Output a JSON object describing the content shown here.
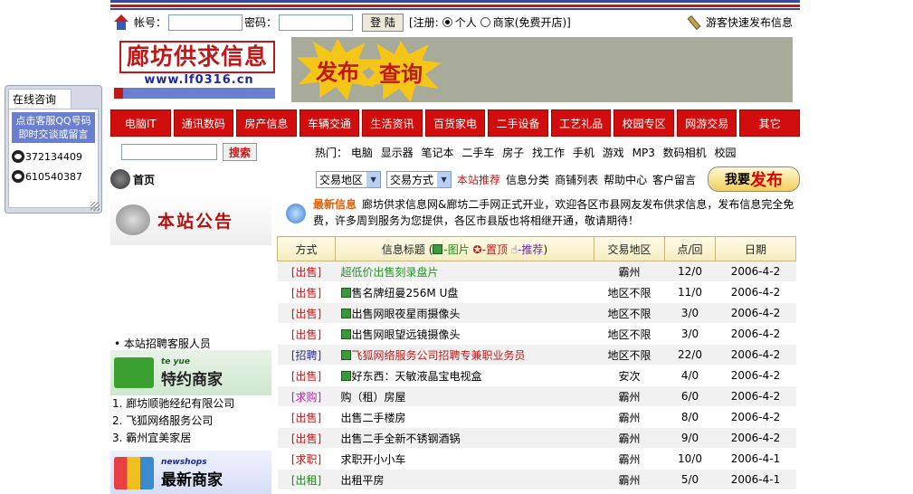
{
  "consult": {
    "title": "在线咨询",
    "tip": "点击客服QQ号码即时交谈或留言",
    "qq": [
      "372134409",
      "610540387"
    ]
  },
  "login": {
    "account_label": "帐号：",
    "password_label": "密码：",
    "login_button": "登 陆",
    "register_label": "[注册:",
    "opt_personal": "个人",
    "opt_business": "商家(免费开店)",
    "close_bracket": "]",
    "guest_publish": "游客快速发布信息"
  },
  "banner": {
    "logo_title": "廊坊供求信息网",
    "logo_url": "www.lf0316.cn",
    "ad_publish": "发布",
    "ad_query": "查询"
  },
  "nav": [
    "电脑IT",
    "通讯数码",
    "房产信息",
    "车辆交通",
    "生活资讯",
    "百货家电",
    "二手设备",
    "工艺礼品",
    "校园专区",
    "网游交易",
    "其它"
  ],
  "search": {
    "button": "搜索",
    "hot_label": "热门：",
    "hot": [
      "电脑",
      "显示器",
      "笔记本",
      "二手车",
      "房子",
      "找工作",
      "手机",
      "游戏",
      "MP3",
      "数码相机",
      "校园"
    ]
  },
  "toolbar": {
    "home": "首页",
    "region_select": "交易地区",
    "method_select": "交易方式",
    "links": [
      "本站推荐",
      "信息分类",
      "商铺列表",
      "帮助中心",
      "客户留言"
    ],
    "publish_btn_a": "我要",
    "publish_btn_b": "发布"
  },
  "left": {
    "announce_title": "本站公告",
    "notice": "• 本站招聘客服人员",
    "special_en": "te yue",
    "special_title": "特约商家",
    "special_list": [
      "1. 廊坊顺驰经纪有限公司",
      "2. 飞狐网络服务公司",
      "3. 霸州宜美家居"
    ],
    "new_en": "newshops",
    "new_title": "最新商家"
  },
  "news": {
    "label": "最新信息",
    "text": "廊坊供求信息网&廊坊二手网正式开业，欢迎各区市县网友发布供求信息，发布信息完全免费，许多周到服务为您提供，各区市县版也将相继开通，敬请期待！"
  },
  "table": {
    "headers": {
      "method": "方式",
      "title": "信息标题",
      "legend_pic": "-图片",
      "legend_top": "-置顶",
      "legend_rec": "-推荐",
      "region": "交易地区",
      "hits": "点/回",
      "date": "日期"
    },
    "rows": [
      {
        "type": "[出售]",
        "title": "超低价出售刻录盘片",
        "pic": false,
        "style": "green",
        "region": "霸州",
        "hits": "12/0",
        "date": "2006-4-2"
      },
      {
        "type": "[出售]",
        "title": "售名牌纽曼256M U盘",
        "pic": true,
        "style": "",
        "region": "地区不限",
        "hits": "11/0",
        "date": "2006-4-2"
      },
      {
        "type": "[出售]",
        "title": "出售网眼夜星雨摄像头",
        "pic": true,
        "style": "",
        "region": "地区不限",
        "hits": "3/0",
        "date": "2006-4-2"
      },
      {
        "type": "[出售]",
        "title": "出售网眼望远镜摄像头",
        "pic": true,
        "style": "",
        "region": "地区不限",
        "hits": "3/0",
        "date": "2006-4-2"
      },
      {
        "type": "[招聘]",
        "title": "飞狐网络服务公司招聘专兼职业务员",
        "pic": true,
        "style": "red",
        "region": "地区不限",
        "hits": "22/0",
        "date": "2006-4-2"
      },
      {
        "type": "[出售]",
        "title": "好东西：天敏液晶宝电视盒",
        "pic": true,
        "style": "",
        "region": "安次",
        "hits": "4/0",
        "date": "2006-4-2"
      },
      {
        "type": "[求购]",
        "title": "购（租）房屋",
        "pic": false,
        "style": "",
        "region": "霸州",
        "hits": "6/0",
        "date": "2006-4-2"
      },
      {
        "type": "[出售]",
        "title": "出售二手楼房",
        "pic": false,
        "style": "",
        "region": "霸州",
        "hits": "8/0",
        "date": "2006-4-2"
      },
      {
        "type": "[出售]",
        "title": "出售二手全新不锈钢酒锅",
        "pic": false,
        "style": "",
        "region": "霸州",
        "hits": "9/0",
        "date": "2006-4-2"
      },
      {
        "type": "[求职]",
        "title": "求职开小小车",
        "pic": false,
        "style": "",
        "region": "霸州",
        "hits": "10/0",
        "date": "2006-4-1"
      },
      {
        "type": "[出租]",
        "title": "出租平房",
        "pic": false,
        "style": "",
        "region": "霸州",
        "hits": "5/0",
        "date": "2006-4-1"
      }
    ]
  }
}
